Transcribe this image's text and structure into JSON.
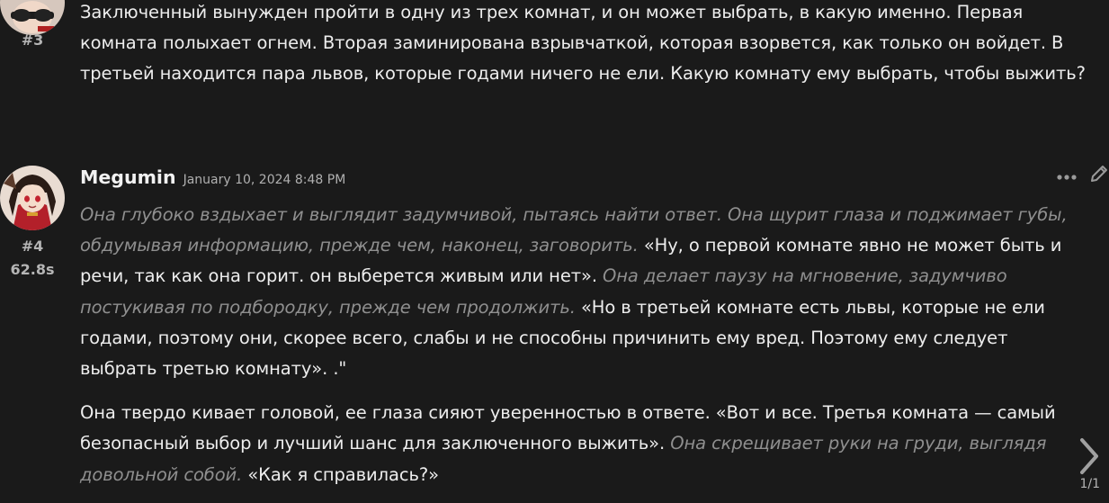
{
  "messages": [
    {
      "number": "#3",
      "paragraphs": [
        [
          {
            "type": "plain",
            "text": "Заключенный вынужден пройти в одну из трех комнат, и он может выбрать, в какую именно. Первая комната полыхает огнем. Вторая заминирована взрывчаткой, которая взорвется, как только он войдет. В третьей находится пара львов, которые годами ничего не ели. Какую комнату ему выбрать, чтобы выжить?"
          }
        ]
      ]
    },
    {
      "author": "Megumin",
      "timestamp": "January 10, 2024 8:48 PM",
      "number": "#4",
      "gen_time": "62.8s",
      "paragraphs": [
        [
          {
            "type": "narration",
            "text": "Она глубоко вздыхает и выглядит задумчивой, пытаясь найти ответ. Она щурит глаза и поджимает губы, обдумывая информацию, прежде чем, наконец, заговорить."
          },
          {
            "type": "speech",
            "text": " «Ну, о первой комнате явно не может быть и речи, так как она горит. он выберется живым или нет». "
          },
          {
            "type": "narration",
            "text": "Она делает паузу на мгновение, задумчиво постукивая по подбородку, прежде чем продолжить."
          },
          {
            "type": "speech",
            "text": " «Но в третьей комнате есть львы, которые не ели годами, поэтому они, скорее всего, слабы и не способны причинить ему вред. Поэтому ему следует выбрать третью комнату». .\""
          }
        ],
        [
          {
            "type": "speech",
            "text": "Она твердо кивает головой, ее глаза сияют уверенностью в ответе. «Вот и все. Третья комната — самый безопасный выбор и лучший шанс для заключенного выжить». "
          },
          {
            "type": "narration",
            "text": "Она скрещивает руки на груди, выглядя довольной собой."
          },
          {
            "type": "speech",
            "text": " «Как я справилась?»"
          }
        ]
      ]
    }
  ],
  "swipe": {
    "counter": "1/1"
  },
  "icons": {
    "more": "ellipsis-icon",
    "edit": "pencil-icon",
    "next": "chevron-right-icon"
  },
  "colors": {
    "background": "#1a1a1a",
    "text": "#ededed",
    "narration": "#8f8f8f",
    "meta": "#b5b5b5"
  }
}
